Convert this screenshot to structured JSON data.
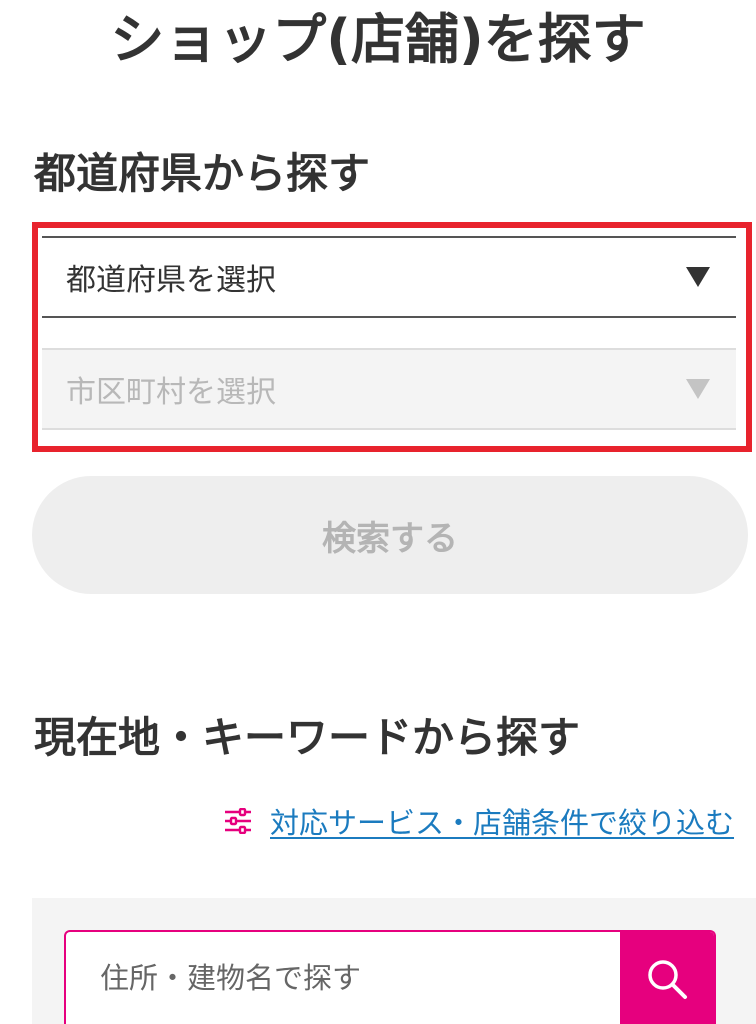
{
  "header": {
    "title": "ショップ(店舗)を探す"
  },
  "prefecture_section": {
    "title": "都道府県から探す",
    "prefecture_select": {
      "value": "都道府県を選択"
    },
    "city_select": {
      "value": "市区町村を選択",
      "disabled": true
    },
    "search_button_label": "検索する"
  },
  "keyword_section": {
    "title": "現在地・キーワードから探す",
    "filter_link_label": "対応サービス・店舗条件で絞り込む",
    "search": {
      "placeholder": "住所・建物名で探す"
    }
  },
  "icons": {
    "filter": "sliders-icon",
    "search": "magnifier-icon",
    "select_arrow": "triangle-down-icon"
  },
  "colors": {
    "accent": "#e6007e",
    "highlight_border": "#e8232d",
    "link": "#1b7bbf",
    "disabled_text": "#b4b4b4"
  }
}
